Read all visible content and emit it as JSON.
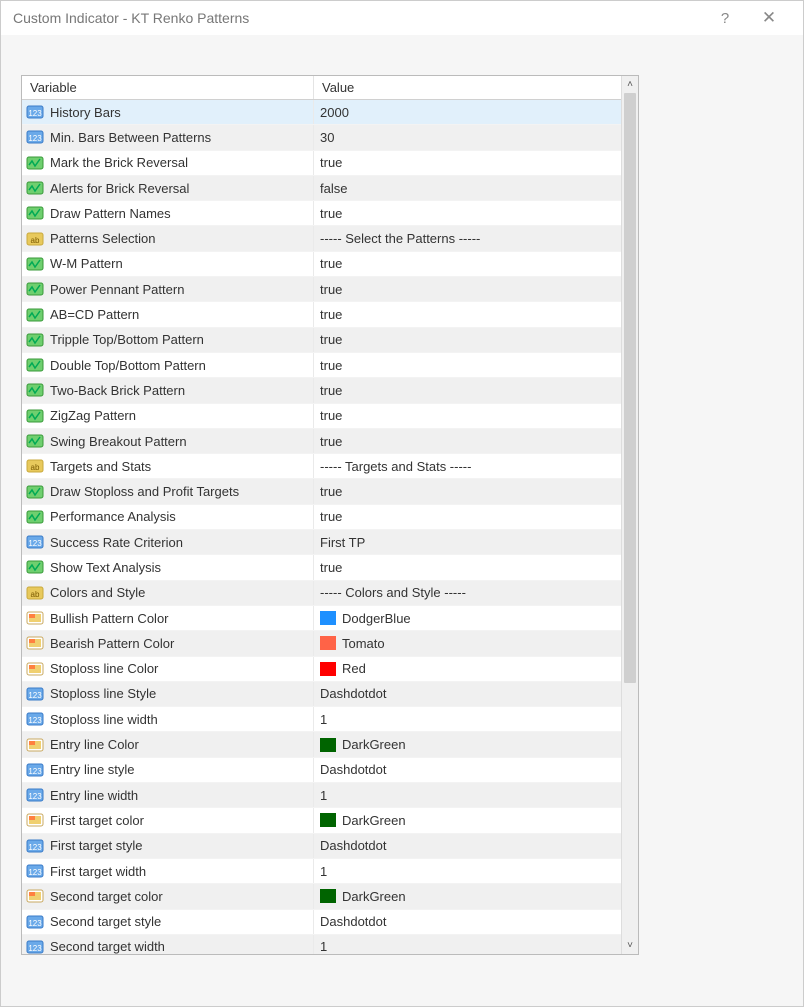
{
  "titlebar": {
    "title": "Custom Indicator - KT Renko Patterns",
    "help": "?",
    "close": "✕"
  },
  "grid": {
    "headers": {
      "variable": "Variable",
      "value": "Value"
    },
    "rows": [
      {
        "icon": "num",
        "label": "History Bars",
        "value": "2000",
        "selected": true
      },
      {
        "icon": "num",
        "label": "Min. Bars Between Patterns",
        "value": "30"
      },
      {
        "icon": "bool",
        "label": "Mark the Brick Reversal",
        "value": "true"
      },
      {
        "icon": "bool",
        "label": "Alerts for Brick Reversal",
        "value": "false"
      },
      {
        "icon": "bool",
        "label": "Draw Pattern Names",
        "value": "true"
      },
      {
        "icon": "str",
        "label": "Patterns Selection",
        "value": "----- Select the Patterns -----"
      },
      {
        "icon": "bool",
        "label": "W-M Pattern",
        "value": "true"
      },
      {
        "icon": "bool",
        "label": "Power Pennant Pattern",
        "value": "true"
      },
      {
        "icon": "bool",
        "label": "AB=CD Pattern",
        "value": "true"
      },
      {
        "icon": "bool",
        "label": "Tripple Top/Bottom Pattern",
        "value": "true"
      },
      {
        "icon": "bool",
        "label": "Double Top/Bottom Pattern",
        "value": "true"
      },
      {
        "icon": "bool",
        "label": "Two-Back Brick Pattern",
        "value": "true"
      },
      {
        "icon": "bool",
        "label": "ZigZag Pattern",
        "value": "true"
      },
      {
        "icon": "bool",
        "label": "Swing Breakout Pattern",
        "value": "true"
      },
      {
        "icon": "str",
        "label": "Targets and Stats",
        "value": "----- Targets and Stats -----"
      },
      {
        "icon": "bool",
        "label": "Draw Stoploss and Profit Targets",
        "value": "true"
      },
      {
        "icon": "bool",
        "label": "Performance Analysis",
        "value": "true"
      },
      {
        "icon": "num",
        "label": "Success Rate Criterion",
        "value": "First TP"
      },
      {
        "icon": "bool",
        "label": "Show Text Analysis",
        "value": "true"
      },
      {
        "icon": "str",
        "label": "Colors and Style",
        "value": "----- Colors and Style -----"
      },
      {
        "icon": "color",
        "label": "Bullish Pattern Color",
        "value": "DodgerBlue",
        "swatch": "#1e90ff"
      },
      {
        "icon": "color",
        "label": "Bearish Pattern Color",
        "value": "Tomato",
        "swatch": "#ff6347"
      },
      {
        "icon": "color",
        "label": "Stoploss line Color",
        "value": "Red",
        "swatch": "#ff0000"
      },
      {
        "icon": "num",
        "label": "Stoploss line Style",
        "value": "Dashdotdot"
      },
      {
        "icon": "num",
        "label": "Stoploss line width",
        "value": "1"
      },
      {
        "icon": "color",
        "label": "Entry line Color",
        "value": "DarkGreen",
        "swatch": "#006400"
      },
      {
        "icon": "num",
        "label": "Entry line style",
        "value": "Dashdotdot"
      },
      {
        "icon": "num",
        "label": "Entry line width",
        "value": "1"
      },
      {
        "icon": "color",
        "label": "First target color",
        "value": "DarkGreen",
        "swatch": "#006400"
      },
      {
        "icon": "num",
        "label": "First target style",
        "value": "Dashdotdot"
      },
      {
        "icon": "num",
        "label": "First target width",
        "value": "1"
      },
      {
        "icon": "color",
        "label": "Second target color",
        "value": "DarkGreen",
        "swatch": "#006400"
      },
      {
        "icon": "num",
        "label": "Second target style",
        "value": "Dashdotdot"
      },
      {
        "icon": "num",
        "label": "Second target width",
        "value": "1"
      }
    ]
  },
  "scrollbar": {
    "up": "˄",
    "down": "˅"
  }
}
